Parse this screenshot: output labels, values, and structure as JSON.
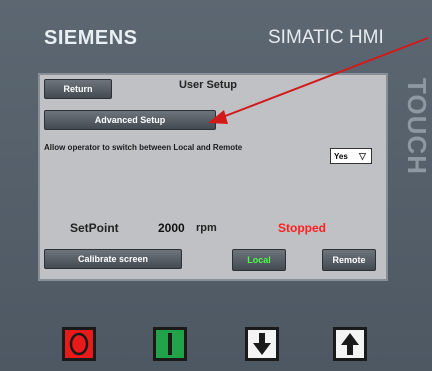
{
  "brand": "SIEMENS",
  "product": "SIMATIC HMI",
  "bezel_label": "TOUCH",
  "screen": {
    "title": "User Setup",
    "return_label": "Return",
    "advanced_label": "Advanced Setup",
    "allow_text": "Allow operator to switch between Local and Remote",
    "select_value": "Yes",
    "setpoint_label": "SetPoint",
    "setpoint_value": "2000",
    "setpoint_unit": "rpm",
    "status": "Stopped",
    "calibrate_label": "Calibrate screen",
    "local_label": "Local",
    "remote_label": "Remote"
  },
  "colors": {
    "status": "#ff2020",
    "local_text": "#49ff49",
    "annotation_arrow": "#d11a1a"
  },
  "icons": [
    "stop-circle-icon",
    "start-bar-icon",
    "arrow-down-icon",
    "arrow-up-icon"
  ]
}
